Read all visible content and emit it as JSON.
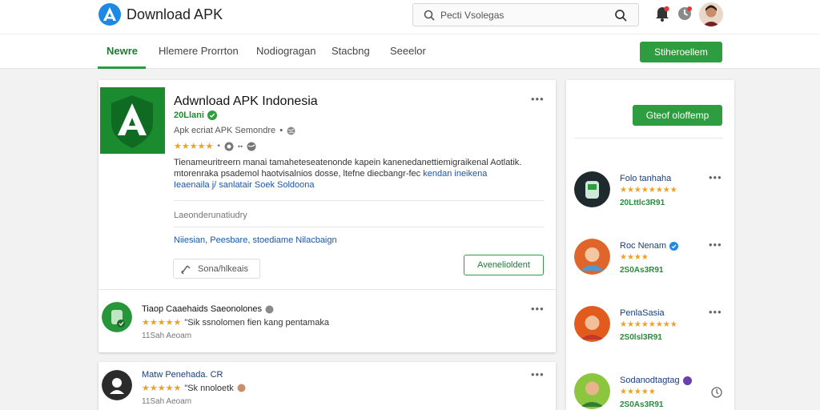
{
  "app": {
    "title": "Download APK"
  },
  "search": {
    "placeholder": "Pecti Vsolegas"
  },
  "nav": {
    "items": [
      {
        "label": "Newre"
      },
      {
        "label": "Hlemere Prorrton"
      },
      {
        "label": "Nodiogragan"
      },
      {
        "label": "Stacbng"
      },
      {
        "label": "Seeelor"
      }
    ],
    "cta_label": "Stiheroellem"
  },
  "post": {
    "title": "Adwnload APK Indonesia",
    "verified_label": "20Llani",
    "subtitle": "Apk ecriat APK Semondre",
    "rating_text": "★★★★★",
    "rating_extra": "••",
    "description": "Tienameuritreern manai tamaheteseatenonde kapein kanenedanettiemigraikenal Aotlatik. mtorenraka psademol haotvisalnios dosse, ltefne diecbangr-fec",
    "description_link": "kendan ineikena",
    "description_line3": "Ieaenaila j/ sanlatair Soek Soldoona",
    "meta_label": "Laeonderunatiudry",
    "tags": "Niiesian, Peesbare, stoediame Nilacbaign",
    "share_label": "Sona/hlkeais",
    "download_label": "Avenelioldent"
  },
  "comments": [
    {
      "name": "Tiaop Caaehaids Saeonolones",
      "rating": "★★★★★",
      "text": "\"Sik ssnolomen fien kang pentamaka",
      "time": "11Sah Aeoam"
    },
    {
      "name": "Matw Penehada. CR",
      "rating": "★★★★★",
      "text": "\"Sk nnoloetk",
      "time": "11Sah Aeoam"
    }
  ],
  "sidebar": {
    "cta_label": "Gteof oloffemp",
    "items": [
      {
        "name": "Folo tanhaha",
        "rating": "★★★★★★★★",
        "time": "20Lttlc3R91"
      },
      {
        "name": "Roc Nenam",
        "rating": "★★★★",
        "time": "2S0As3R91"
      },
      {
        "name": "PenlaSasia",
        "rating": "★★★★★★★★",
        "time": "2S0lsl3R91"
      },
      {
        "name": "Sodanodtagtag",
        "rating": "★★★★★",
        "time": "2S0As3R91"
      }
    ]
  },
  "colors": {
    "brand_green": "#2e9d3f",
    "link_blue": "#1a56a8",
    "star": "#f0a121"
  }
}
